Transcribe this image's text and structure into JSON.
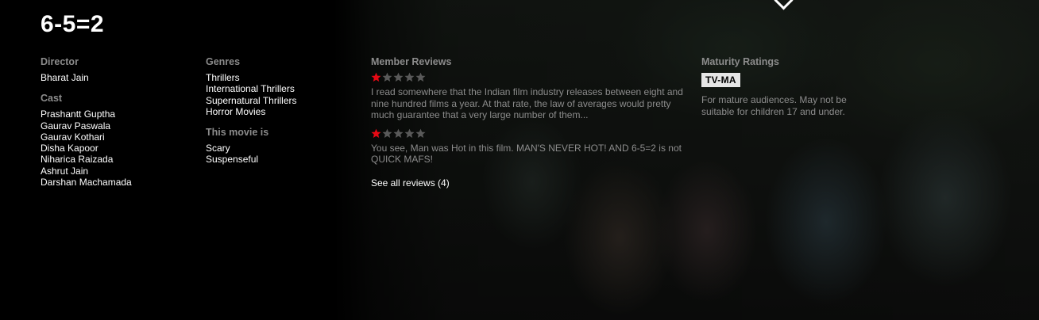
{
  "title": "6-5=2",
  "director": {
    "heading": "Director",
    "names": [
      "Bharat Jain"
    ]
  },
  "cast": {
    "heading": "Cast",
    "names": [
      "Prashantt Guptha",
      "Gaurav Paswala",
      "Gaurav Kothari",
      "Disha Kapoor",
      "Niharica Raizada",
      "Ashrut Jain",
      "Darshan Machamada"
    ]
  },
  "genres": {
    "heading": "Genres",
    "items": [
      "Thrillers",
      "International Thrillers",
      "Supernatural Thrillers",
      "Horror Movies"
    ]
  },
  "this_movie_is": {
    "heading": "This movie is",
    "items": [
      "Scary",
      "Suspenseful"
    ]
  },
  "reviews": {
    "heading": "Member Reviews",
    "items": [
      {
        "stars_filled": 1,
        "stars_total": 5,
        "text": "I read somewhere that the Indian film industry releases between eight and nine hundred films a year. At that rate, the law of averages would pretty much guarantee that a very large number of them..."
      },
      {
        "stars_filled": 1,
        "stars_total": 5,
        "text": "You see, Man was Hot in this film. MAN'S NEVER HOT! AND 6-5=2 is not QUICK MAFS!"
      }
    ],
    "see_all_label": "See all reviews (4)"
  },
  "maturity": {
    "heading": "Maturity Ratings",
    "rating": "TV-MA",
    "description": "For mature audiences. May not be suitable for children 17 and under."
  },
  "colors": {
    "star_filled": "#e50914",
    "star_empty": "#595959",
    "heading": "#8c8c8c",
    "text": "#ffffff"
  },
  "icons": {
    "star": "star-icon",
    "chevron": "chevron-down-icon"
  }
}
